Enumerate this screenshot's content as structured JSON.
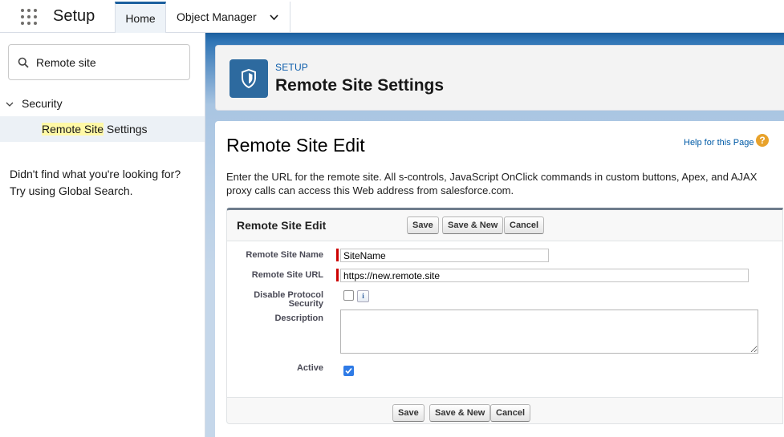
{
  "app": {
    "name": "Setup"
  },
  "tabs": [
    {
      "label": "Home",
      "active": true
    },
    {
      "label": "Object Manager",
      "active": false
    }
  ],
  "sidebar": {
    "search_value": "Remote site",
    "tree": {
      "parent_label": "Security",
      "child_label_highlight": "Remote Site",
      "child_label_rest": " Settings"
    },
    "not_found_line1": "Didn't find what you're looking for?",
    "not_found_line2": "Try using Global Search."
  },
  "header": {
    "eyebrow": "SETUP",
    "title": "Remote Site Settings",
    "icon": "shield-icon"
  },
  "content": {
    "title": "Remote Site Edit",
    "help_link": "Help for this Page",
    "intro": "Enter the URL for the remote site. All s-controls, JavaScript OnClick commands in custom buttons, Apex, and AJAX proxy calls can access this Web address from salesforce.com."
  },
  "form": {
    "title": "Remote Site Edit",
    "buttons": {
      "save": "Save",
      "save_new": "Save & New",
      "cancel": "Cancel"
    },
    "fields": {
      "name_label": "Remote Site Name",
      "name_value": "SiteName",
      "url_label": "Remote Site URL",
      "url_value": "https://new.remote.site",
      "disable_label_1": "Disable Protocol",
      "disable_label_2": "Security",
      "disable_checked": false,
      "description_label": "Description",
      "description_value": "",
      "active_label": "Active",
      "active_checked": true
    }
  },
  "colors": {
    "brand_blue": "#1b5f9e",
    "setup_icon_bg": "#2d6a9f",
    "required_bar": "#cc0000",
    "highlight": "#fff9a6"
  }
}
